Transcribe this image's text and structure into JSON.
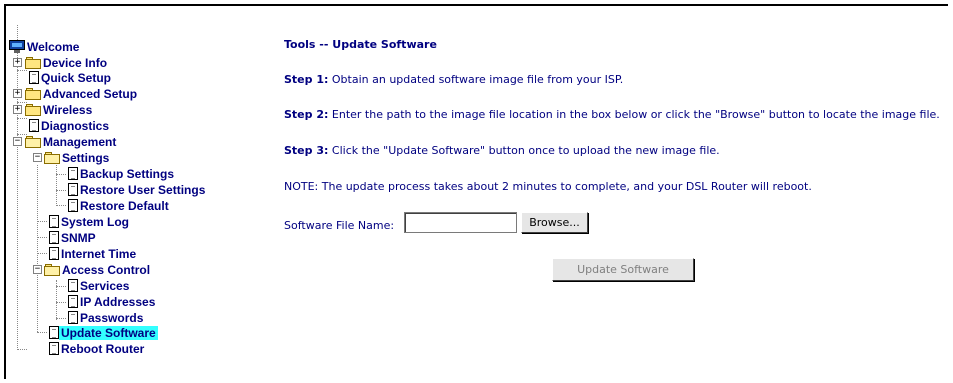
{
  "nav": {
    "welcome": "Welcome",
    "device_info": "Device Info",
    "quick_setup": "Quick Setup",
    "advanced_setup": "Advanced Setup",
    "wireless": "Wireless",
    "diagnostics": "Diagnostics",
    "management": "Management",
    "settings": "Settings",
    "backup_settings": "Backup Settings",
    "restore_user_settings": "Restore User Settings",
    "restore_default": "Restore Default",
    "system_log": "System Log",
    "snmp": "SNMP",
    "internet_time": "Internet Time",
    "access_control": "Access Control",
    "services": "Services",
    "ip_addresses": "IP Addresses",
    "passwords": "Passwords",
    "update_software": "Update Software",
    "reboot_router": "Reboot Router"
  },
  "main": {
    "title": "Tools -- Update Software",
    "step1_label": "Step 1:",
    "step1_text": " Obtain an updated software image file from your ISP.",
    "step2_label": "Step 2:",
    "step2_text": " Enter the path to the image file location in the box below or click the \"Browse\" button to locate the image file.",
    "step3_label": "Step 3:",
    "step3_text": " Click the \"Update Software\" button once to upload the new image file.",
    "note": "NOTE: The update process takes about 2 minutes to complete, and your DSL Router will reboot.",
    "file_label": "Software File Name:",
    "file_value": "",
    "browse_label": "Browse...",
    "update_label": "Update Software"
  },
  "colors": {
    "link": "#000080",
    "selected_bg": "#33ffff"
  }
}
